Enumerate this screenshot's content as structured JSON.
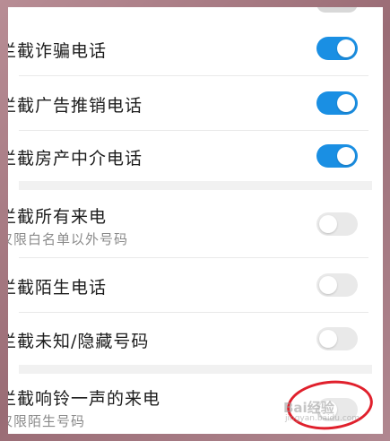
{
  "settings": {
    "rows": [
      {
        "title": "拦截诈骗电话",
        "enabled": true
      },
      {
        "title": "拦截广告推销电话",
        "enabled": true
      },
      {
        "title": "拦截房产中介电话",
        "enabled": true
      },
      {
        "title": "拦截所有来电",
        "subtitle": "仅限白名单以外号码",
        "enabled": false
      },
      {
        "title": "拦截陌生电话",
        "enabled": false
      },
      {
        "title": "拦截未知/隐藏号码",
        "enabled": false
      },
      {
        "title": "拦截响铃一声的来电",
        "subtitle": "仅限陌生号码",
        "enabled": false
      }
    ]
  },
  "colors": {
    "accent": "#1a8fe3",
    "toggle_off": "#e9e9e9",
    "annotation": "#e0202c"
  },
  "watermark": {
    "logo_text": "Bai经验",
    "sub_text": "jingyan.baidu.com"
  }
}
